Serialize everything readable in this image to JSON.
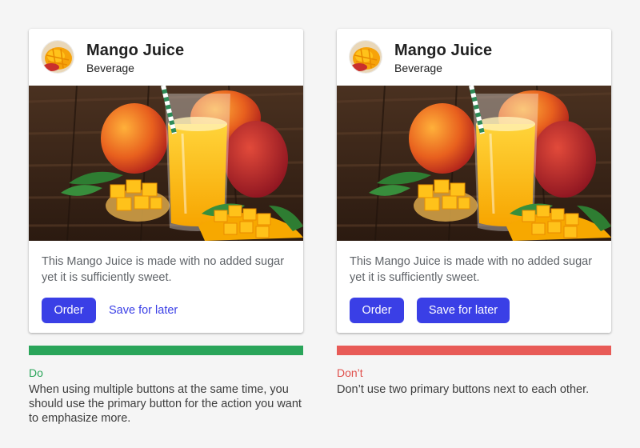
{
  "colors": {
    "background": "#f5f5f5",
    "primary": "#3a3fe6",
    "do_accent": "#2aa55a",
    "dont_accent": "#e85b57"
  },
  "examples": [
    {
      "card": {
        "title": "Mango Juice",
        "subtitle": "Beverage",
        "avatar_icon": "mango-icon",
        "media": "mango-juice-photo",
        "body": "This Mango Juice is made with no added sugar yet it is sufficiently sweet.",
        "primary_button": "Order",
        "secondary_button": "Save for later"
      },
      "guideline": {
        "label": "Do",
        "text": "When using multiple buttons at the same time, you should use the primary button for the action you want to emphasize more."
      }
    },
    {
      "card": {
        "title": "Mango Juice",
        "subtitle": "Beverage",
        "avatar_icon": "mango-icon",
        "media": "mango-juice-photo",
        "body": "This Mango Juice is made with no added sugar yet it is sufficiently sweet.",
        "primary_button": "Order",
        "secondary_button": "Save for later"
      },
      "guideline": {
        "label": "Don’t",
        "text": "Don’t use two primary buttons next to each other."
      }
    }
  ]
}
